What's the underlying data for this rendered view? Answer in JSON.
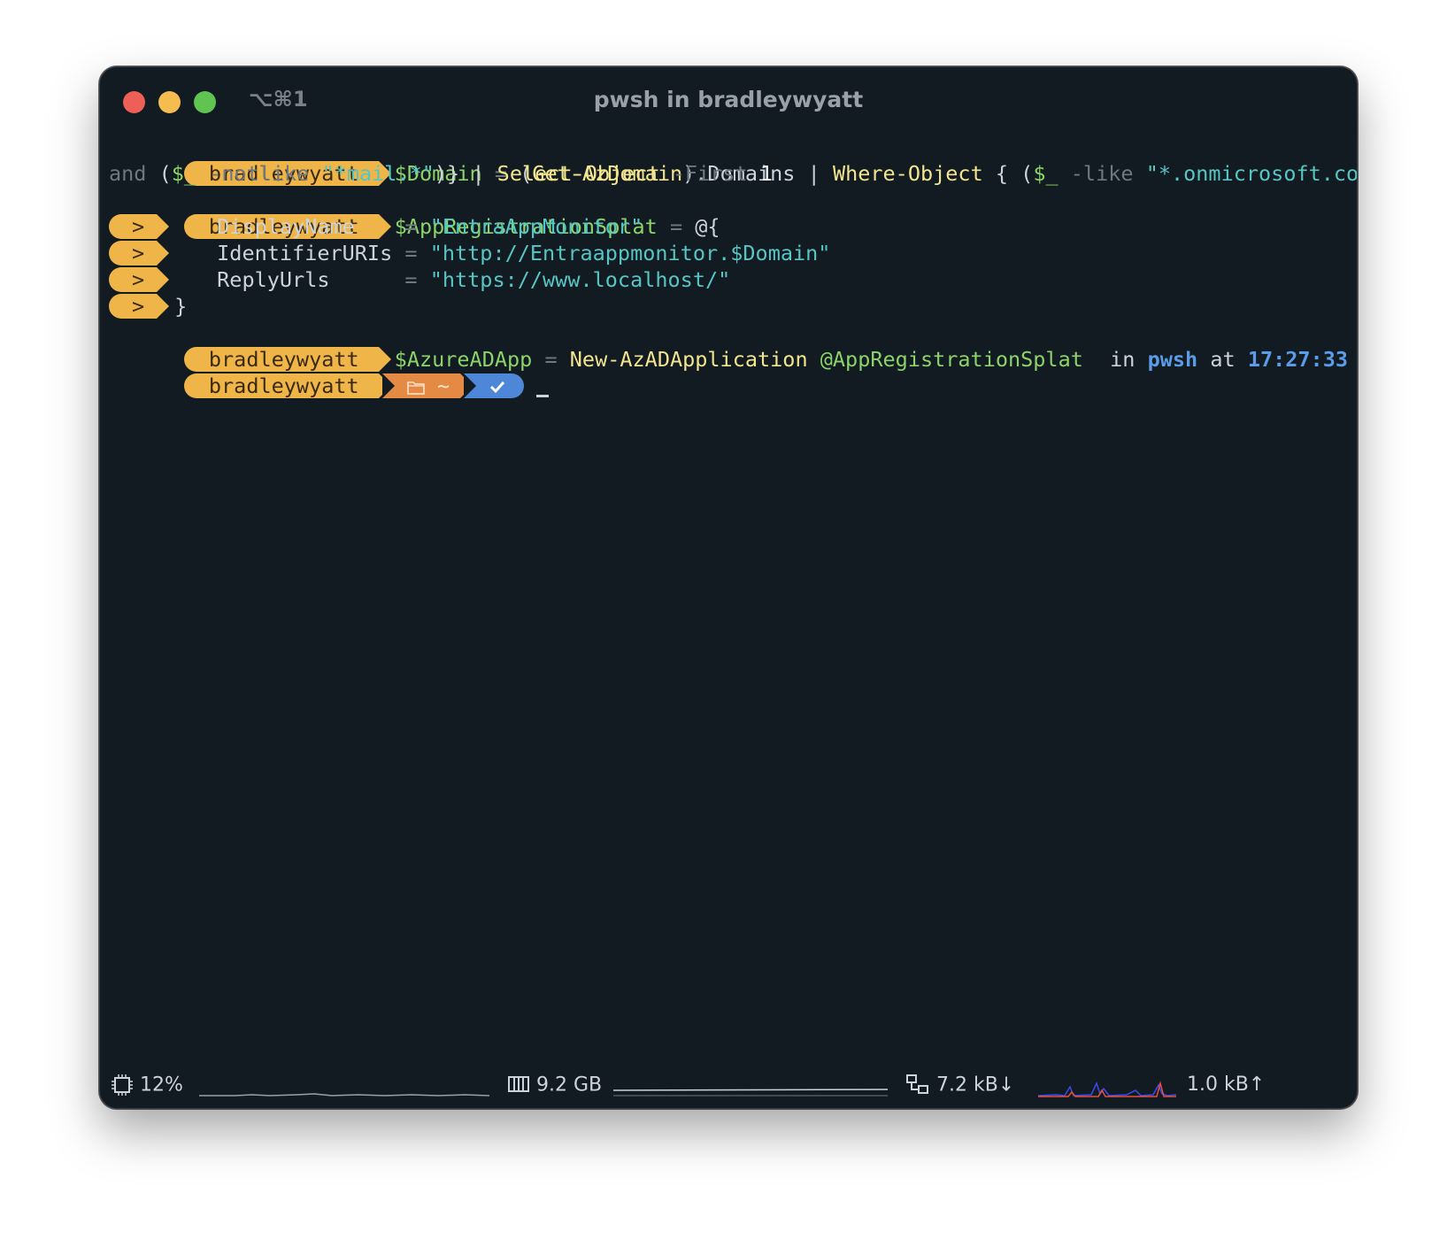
{
  "window": {
    "shortcut": "⌥⌘1",
    "title": "pwsh in bradleywyatt"
  },
  "prompt": {
    "user": "bradleywyatt",
    "continuation": ">",
    "path": "~",
    "status_icon": "checkmark-icon",
    "right": {
      "in_label": "in",
      "shell": "pwsh",
      "at_label": "at",
      "time": "17:27:33"
    }
  },
  "lines": {
    "l1": {
      "var": "$Domain",
      "eq": "=",
      "p1": "(",
      "cmd1": "Get-AzDomain",
      "p2": ").Domains",
      "pipe": "|",
      "cmd2": "Where-Object",
      "brace": "{ (",
      "var2": "$_",
      "op1": "-like",
      "str1": "\"*.onmicrosoft.com*\"",
      "close1": ")",
      "dash": "-"
    },
    "l1b": {
      "and": "and",
      "p1": "(",
      "var": "$_",
      "op": "-notlike",
      "str": "\"*mail.*\"",
      "close": ")}",
      "pipe": "|",
      "cmd": "Select-Object",
      "param": "-First",
      "num": "1"
    },
    "l2": {
      "var": "$AppRegistrationSplat",
      "eq": "=",
      "open": "@{"
    },
    "l3": {
      "key": "DisplayName",
      "eq": "=",
      "val": "\"EntraAppMonitor\""
    },
    "l4": {
      "key": "IdentifierURIs",
      "eq": "=",
      "val": "\"http://Entraappmonitor.$Domain\""
    },
    "l5": {
      "key": "ReplyUrls",
      "eq": "=",
      "val": "\"https://www.localhost/\""
    },
    "l6": {
      "close": "}"
    },
    "l7": {
      "var": "$AzureADApp",
      "eq": "=",
      "cmd": "New-AzADApplication",
      "arg": "@AppRegistrationSplat"
    }
  },
  "status_bar": {
    "cpu": {
      "icon": "cpu-icon",
      "value": "12%"
    },
    "memory": {
      "icon": "memory-icon",
      "value": "9.2 GB"
    },
    "network": {
      "icon": "network-icon",
      "down": "7.2 kB↓",
      "up": "1.0 kB↑"
    }
  },
  "colors": {
    "background": "#121a22",
    "prompt_user": "#f0b548",
    "prompt_path": "#e58a44",
    "prompt_ok": "#4e86d8",
    "variable": "#8bd36a",
    "command": "#f2e58e",
    "string": "#56c6c4"
  }
}
